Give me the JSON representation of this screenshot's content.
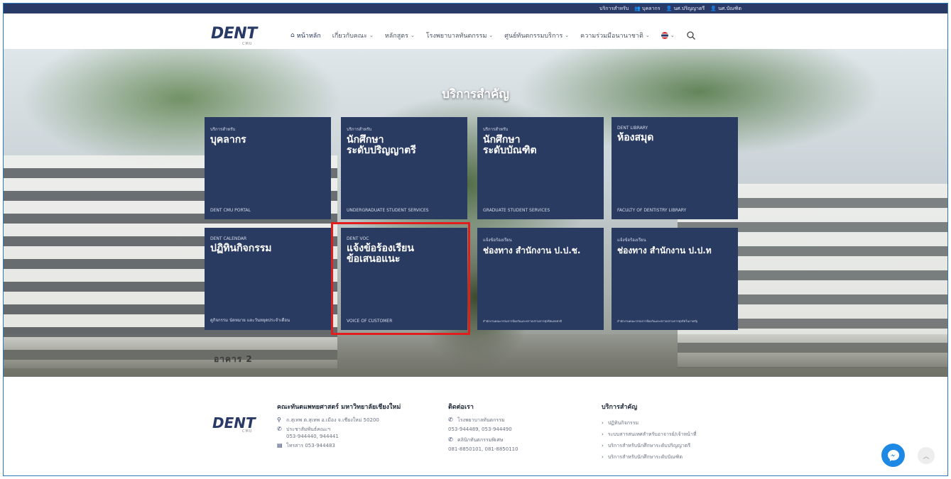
{
  "utility": {
    "link1": "บริการสำหรับ",
    "link2": "บุคลากร",
    "link3": "นศ.ปริญญาตรี",
    "link4": "นศ.บัณฑิต"
  },
  "header": {
    "logo": "DENT",
    "logo_sub": "CMU",
    "nav": {
      "home": "หน้าหลัก",
      "about": "เกี่ยวกับคณะ",
      "curriculum": "หลักสูตร",
      "hospital": "โรงพยาบาลทันตกรรม",
      "services_center": "ศูนย์ทันตกรรมบริการ",
      "international": "ความร่วมมือนานาชาติ"
    }
  },
  "hero": {
    "title": "บริการสำคัญ",
    "building_label": "อาคาร 2",
    "cards": [
      {
        "kicker": "บริการสำหรับ",
        "title": "บุคลากร",
        "foot": "DENT CMU PORTAL"
      },
      {
        "kicker": "บริการสำหรับ",
        "title": "นักศึกษา\nระดับปริญญาตรี",
        "foot": "UNDERGRADUATE STUDENT SERVICES"
      },
      {
        "kicker": "บริการสำหรับ",
        "title": "นักศึกษา\nระดับบัณฑิต",
        "foot": "GRADUATE STUDENT SERVICES"
      },
      {
        "kicker": "DENT LIBRARY",
        "title": "ห้องสมุด",
        "foot": "FACULTY OF DENTISTRY LIBRARY"
      },
      {
        "kicker": "DENT CALENDAR",
        "title": "ปฏิทินกิจกรรม",
        "foot": "ดูกิจกรรม นัดหมาย และวันหยุดประจำเดือน"
      },
      {
        "kicker": "DENT VOC",
        "title": "แจ้งข้อร้องเรียน\nข้อเสนอแนะ",
        "foot": "VOICE OF CUSTOMER"
      },
      {
        "kicker": "แจ้งข้อร้องเรียน",
        "title": "ช่องทาง สำนักงาน ป.ป.ช.",
        "foot": "สำนักงานคณะกรรมการป้องกันและปราบปรามการทุจริตแห่งชาติ"
      },
      {
        "kicker": "แจ้งข้อร้องเรียน",
        "title": "ช่องทาง สำนักงาน ป.ป.ท",
        "foot": "สำนักงานคณะกรรมการป้องกันและปราบปรามการทุจริตในภาครัฐ"
      }
    ]
  },
  "footer": {
    "logo": "DENT",
    "logo_sub": "CMU",
    "faculty": {
      "title": "คณะทันตแพทยศาสตร์ มหาวิทยาลัยเชียงใหม่",
      "address": "ถ.สุเทพ ต.สุเทพ อ.เมือง จ.เชียงใหม่ 50200",
      "pr_label": "ประชาสัมพันธ์คณะฯ",
      "pr_phone": "053-944440, 944441",
      "fax": "โทรสาร 053-944483"
    },
    "contact": {
      "title": "ติดต่อเรา",
      "hospital_label": "โรงพยาบาลทันตกรรม",
      "hospital_phone": "053-944489, 053-944490",
      "clinic_label": "คลินิกทันตกรรมพิเศษ",
      "clinic_phone": "081-8850101, 081-8850110"
    },
    "services": {
      "title": "บริการสำคัญ",
      "items": [
        "ปฏิทินกิจกรรม",
        "ระบบสารสนเทศสำหรับอาจารย์/เจ้าหน้าที่",
        "บริการสำหรับนักศึกษาระดับปริญญาตรี",
        "บริการสำหรับนักศึกษาระดับบัณฑิต"
      ]
    }
  }
}
